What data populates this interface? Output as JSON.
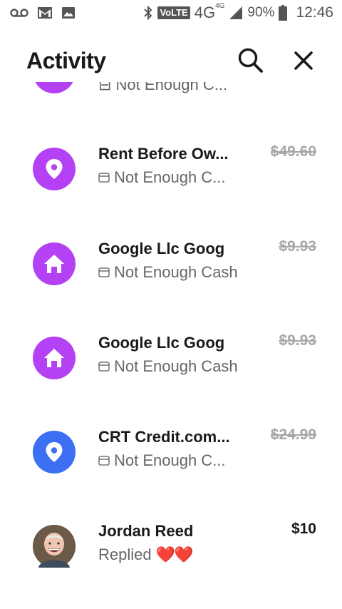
{
  "status_bar": {
    "volte": "VoLTE",
    "network": "4G",
    "network_sup": "4G",
    "battery": "90%",
    "time": "12:46"
  },
  "header": {
    "title": "Activity"
  },
  "partial_row": {
    "status": "Not Enough C..."
  },
  "activity": [
    {
      "name": "Rent Before Ow...",
      "status": "Not Enough C...",
      "amount": "$49.60",
      "icon": "location-pin-icon",
      "color": "#b541f5"
    },
    {
      "name": "Google Llc Goog",
      "status": "Not Enough Cash",
      "amount": "$9.93",
      "icon": "house-icon",
      "color": "#b541f5"
    },
    {
      "name": "Google Llc Goog",
      "status": "Not Enough Cash",
      "amount": "$9.93",
      "icon": "house-icon",
      "color": "#b541f5"
    },
    {
      "name": "CRT Credit.com...",
      "status": "Not Enough C...",
      "amount": "$24.99",
      "icon": "location-pin-icon",
      "color": "#3d6ff4"
    },
    {
      "name": "Jordan Reed",
      "status": "Replied",
      "amount": "$10",
      "icon": "avatar-photo",
      "hearts": "❤️❤️"
    }
  ]
}
